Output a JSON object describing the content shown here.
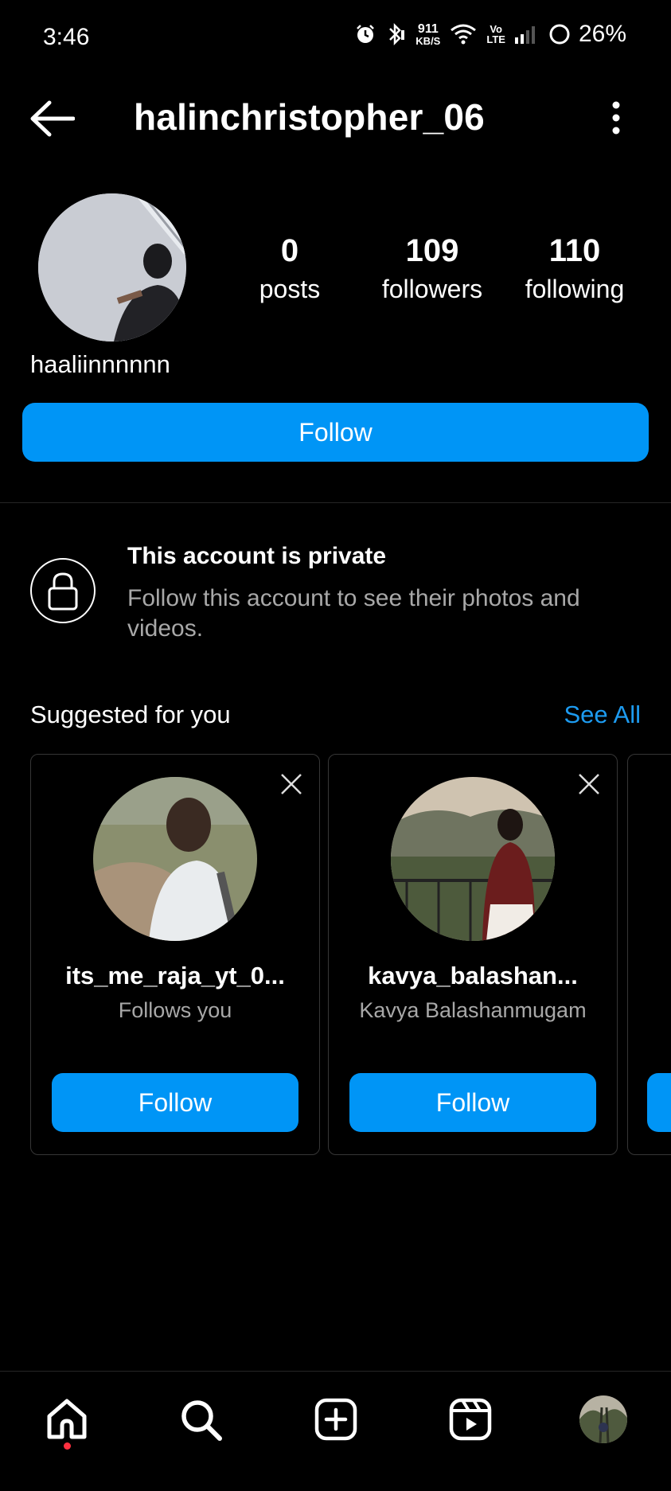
{
  "status_bar": {
    "time": "3:46",
    "speed_value": "911",
    "speed_unit": "KB/S",
    "volte_top": "Vo",
    "volte_bottom": "LTE",
    "battery": "26%"
  },
  "header": {
    "username": "halinchristopher_06",
    "back_icon": "arrow-left-icon",
    "more_icon": "more-vertical-icon"
  },
  "profile": {
    "display_name": "haaliinnnnnn",
    "stats": [
      {
        "value": "0",
        "label": "posts"
      },
      {
        "value": "109",
        "label": "followers"
      },
      {
        "value": "110",
        "label": "following"
      }
    ],
    "follow_label": "Follow"
  },
  "private_notice": {
    "title": "This account is private",
    "description": "Follow this account to see their photos and videos."
  },
  "suggested": {
    "title": "Suggested for you",
    "see_all": "See All",
    "cards": [
      {
        "username": "its_me_raja_yt_0...",
        "subtitle": "Follows you",
        "follow_label": "Follow"
      },
      {
        "username": "kavya_balashan...",
        "subtitle": "Kavya Balashanmugam",
        "follow_label": "Follow"
      }
    ]
  },
  "bottom_nav": {
    "items": [
      "home-icon",
      "search-icon",
      "create-post-icon",
      "reels-icon",
      "profile-avatar"
    ]
  },
  "colors": {
    "background": "#000000",
    "accent": "#0095f6",
    "link": "#1d9bf0",
    "secondary_text": "#a8a8a8"
  }
}
